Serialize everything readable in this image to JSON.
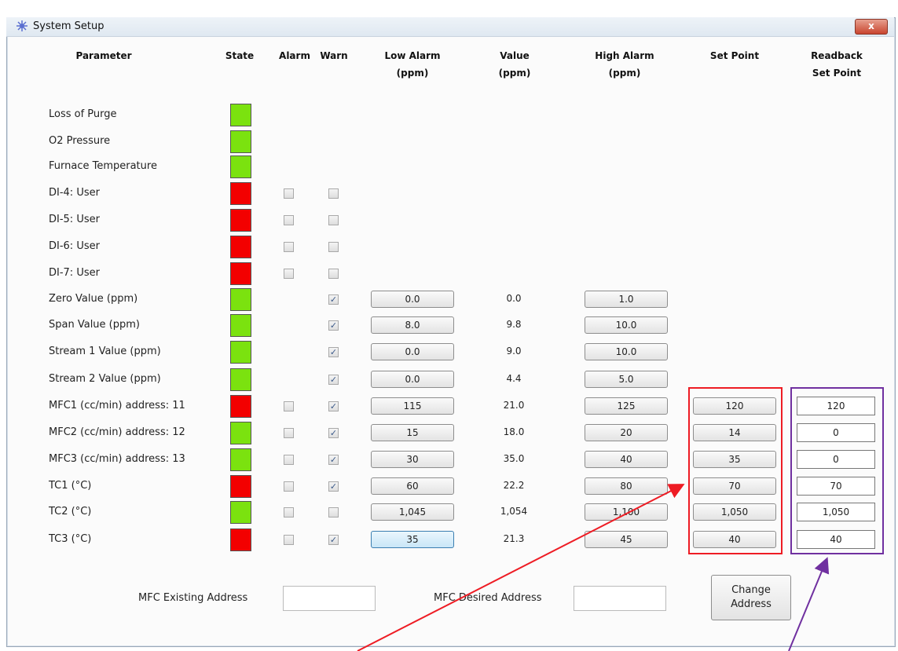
{
  "window": {
    "title": "System Setup",
    "close_glyph": "x"
  },
  "headers": {
    "parameter": "Parameter",
    "state": "State",
    "alarm": "Alarm",
    "warn": "Warn",
    "low_alarm_1": "Low Alarm",
    "low_alarm_2": "(ppm)",
    "value_1": "Value",
    "value_2": "(ppm)",
    "high_alarm_1": "High Alarm",
    "high_alarm_2": "(ppm)",
    "set_point": "Set Point",
    "readback_1": "Readback",
    "readback_2": "Set Point"
  },
  "rows": [
    {
      "label": "Loss of Purge",
      "state": "green"
    },
    {
      "label": "O2 Pressure",
      "state": "green"
    },
    {
      "label": "Furnace Temperature",
      "state": "green"
    },
    {
      "label": "DI-4: User",
      "state": "red",
      "alarm": false,
      "warn": false
    },
    {
      "label": "DI-5: User",
      "state": "red",
      "alarm": false,
      "warn": false
    },
    {
      "label": "DI-6: User",
      "state": "red",
      "alarm": false,
      "warn": false
    },
    {
      "label": "DI-7: User",
      "state": "red",
      "alarm": false,
      "warn": false
    },
    {
      "label": "Zero Value (ppm)",
      "state": "green",
      "warn": true,
      "low": "0.0",
      "value": "0.0",
      "high": "1.0"
    },
    {
      "label": "Span Value (ppm)",
      "state": "green",
      "warn": true,
      "low": "8.0",
      "value": "9.8",
      "high": "10.0"
    },
    {
      "label": "Stream 1 Value (ppm)",
      "state": "green",
      "warn": true,
      "low": "0.0",
      "value": "9.0",
      "high": "10.0"
    },
    {
      "label": "Stream 2 Value (ppm)",
      "state": "green",
      "warn": true,
      "low": "0.0",
      "value": "4.4",
      "high": "5.0"
    },
    {
      "label": "MFC1 (cc/min)  address: 11",
      "state": "red",
      "alarm": false,
      "warn": true,
      "low": "115",
      "value": "21.0",
      "high": "125",
      "set_point": "120",
      "readback": "120"
    },
    {
      "label": "MFC2 (cc/min)  address: 12",
      "state": "green",
      "alarm": false,
      "warn": true,
      "low": "15",
      "value": "18.0",
      "high": "20",
      "set_point": "14",
      "readback": "0"
    },
    {
      "label": "MFC3 (cc/min)  address: 13",
      "state": "green",
      "alarm": false,
      "warn": true,
      "low": "30",
      "value": "35.0",
      "high": "40",
      "set_point": "35",
      "readback": "0"
    },
    {
      "label": "TC1 (°C)",
      "state": "red",
      "alarm": false,
      "warn": true,
      "low": "60",
      "value": "22.2",
      "high": "80",
      "set_point": "70",
      "readback": "70"
    },
    {
      "label": "TC2 (°C)",
      "state": "green",
      "alarm": false,
      "warn": false,
      "low": "1,045",
      "value": "1,054",
      "high": "1,100",
      "set_point": "1,050",
      "readback": "1,050"
    },
    {
      "label": "TC3 (°C)",
      "state": "red",
      "alarm": false,
      "warn": true,
      "low": "35",
      "value": "21.3",
      "high": "45",
      "set_point": "40",
      "readback": "40"
    }
  ],
  "bottom": {
    "existing_label": "MFC Existing Address",
    "existing_value": "",
    "desired_label": "MFC Desired Address",
    "desired_value": "",
    "change_line1": "Change",
    "change_line2": "Address"
  },
  "colors": {
    "state_green": "#7be20f",
    "state_red": "#f30000",
    "annotation_red": "#ee1c24",
    "annotation_purple": "#7030a0"
  }
}
